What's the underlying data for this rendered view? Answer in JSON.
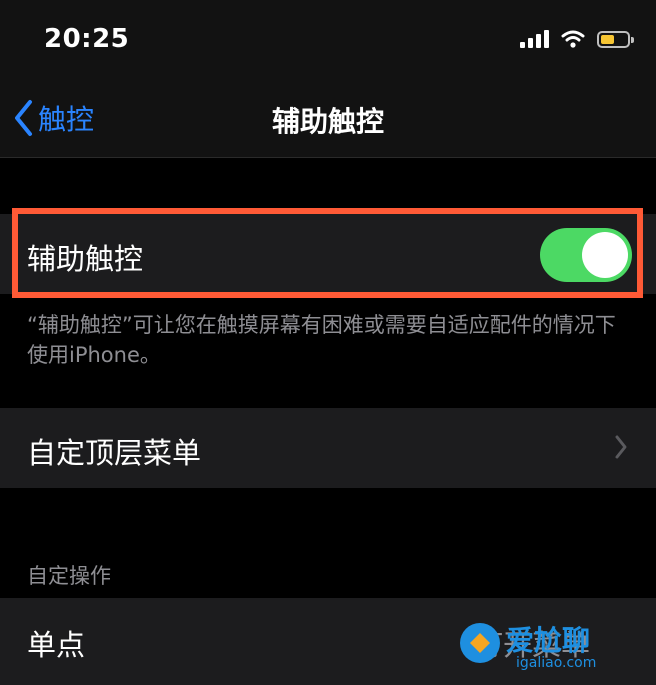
{
  "status_bar": {
    "time": "20:25",
    "icons": [
      "cellular-signal-icon",
      "wifi-icon",
      "battery-charging-icon"
    ],
    "battery_color": "#f6c533"
  },
  "nav": {
    "back_label": "触控",
    "title": "辅助触控",
    "accent_color": "#2a84ff"
  },
  "assistive_touch": {
    "label": "辅助触控",
    "toggle_on": true,
    "toggle_color": "#4cd964",
    "highlight_color": "#ff5a36",
    "footnote": "“辅助触控”可让您在触摸屏幕有困难或需要自适应配件的情况下使用iPhone。"
  },
  "top_menu": {
    "label": "自定顶层菜单"
  },
  "custom_actions": {
    "header": "自定操作",
    "rows": [
      {
        "label": "单点",
        "value": "打开菜单"
      }
    ]
  },
  "watermark": {
    "main": "爱尬聊",
    "sub": "igaliao.com"
  }
}
